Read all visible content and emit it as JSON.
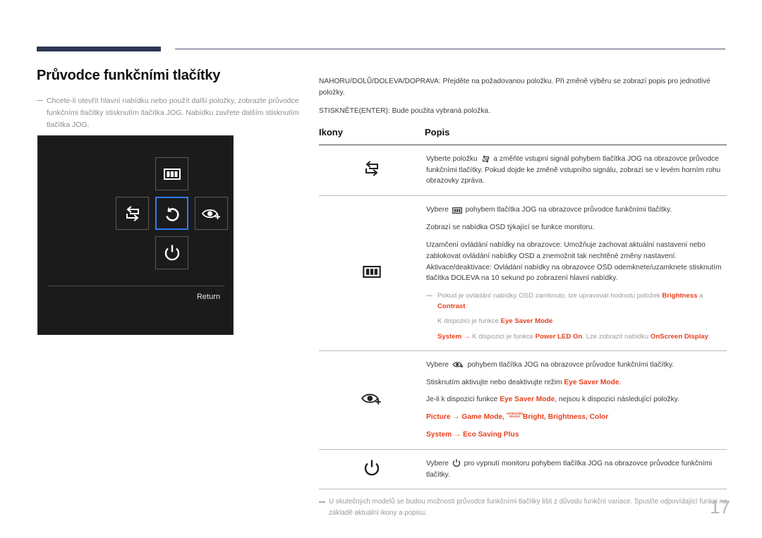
{
  "page": {
    "number": "17",
    "language": "cs"
  },
  "header": {
    "accent_color": "#2e3756",
    "rule_color": "#4a5470"
  },
  "left_column": {
    "title": "Průvodce funkčními tlačítky",
    "note": "Chcete-li otevřít hlavní nabídku nebo použít další položky, zobrazte průvodce funkčními tlačítky stisknutím tlačítka JOG. Nabídku zavřete dalším stisknutím tlačítka JOG.",
    "osd": {
      "background": "#1b1b1b",
      "highlight_color": "#2f7cf6",
      "return_label": "Return",
      "keys": [
        {
          "position": "up",
          "icon": "menu-icon",
          "selected": false
        },
        {
          "position": "left",
          "icon": "source-loop-icon",
          "selected": false
        },
        {
          "position": "center",
          "icon": "return-arrow-icon",
          "selected": true
        },
        {
          "position": "right",
          "icon": "eye-saver-icon",
          "selected": false
        },
        {
          "position": "down",
          "icon": "power-icon",
          "selected": false
        }
      ]
    }
  },
  "right_column": {
    "intro_1": "NAHORU/DOLŮ/DOLEVA/DOPRAVA: Přejděte na požadovanou položku. Při změně výběru se zobrazí popis pro jednotlivé položky.",
    "intro_2": "STISKNĚTE(ENTER): Bude použita vybraná položka.",
    "table": {
      "headers": {
        "icons": "Ikony",
        "description": "Popis"
      },
      "rows": [
        {
          "icon": "source-loop-icon",
          "paragraphs": {
            "p1_a": "Vyberte položku",
            "p1_b": "a změňte vstupní signál pohybem tlačítka JOG na obrazovce průvodce funkčními tlačítky. Pokud dojde ke změně vstupního signálu, zobrazí se v levém horním rohu obrazovky zpráva."
          }
        },
        {
          "icon": "menu-icon",
          "paragraphs": {
            "p1_a": "Vybere",
            "p1_b": "pohybem tlačítka JOG na obrazovce průvodce funkčními tlačítky.",
            "p2": "Zobrazí se nabídka OSD týkající se funkce monitoru.",
            "p3": "Uzamčení ovládání nabídky na obrazovce: Umožňuje zachovat aktuální nastavení nebo zablokovat ovládání nabídky OSD a znemožnit tak nechtěné změny nastavení. Aktivace/deaktivace: Ovládání nabídky na obrazovce OSD odemknete/uzamknete stisknutím tlačítka DOLEVA na 10 sekund po zobrazení hlavní nabídky."
          },
          "sub_notes": {
            "s1_a": "Pokud je ovládání nabídky OSD zamknuto, lze upravovat hodnotu položek",
            "s1_k1": "Brightness",
            "s1_b": "a",
            "s1_k2": "Contrast",
            "s1_c": ".",
            "s2_a": "K dispozici je funkce",
            "s2_k1": "Eye Saver Mode",
            "s2_b": ".",
            "s3_k1": "System",
            "s3_arrow": "→",
            "s3_a": "K dispozici je funkce",
            "s3_k2": "Power LED On",
            "s3_b": ". Lze zobrazit nabídku",
            "s3_k3": "OnScreen Display",
            "s3_c": "."
          }
        },
        {
          "icon": "eye-saver-icon",
          "paragraphs": {
            "p1_a": "Vybere",
            "p1_b": "pohybem tlačítka JOG na obrazovce průvodce funkčními tlačítky.",
            "p2_a": "Stisknutím aktivujte nebo deaktivujte režim",
            "p2_k": "Eye Saver Mode",
            "p2_b": ".",
            "p3_a": "Je-li k dispozici funkce",
            "p3_k": "Eye Saver Mode",
            "p3_b": ", nejsou k dispozici následující položky."
          },
          "paths": {
            "r1_k1": "Picture",
            "r1_arrow": "→",
            "r1_k2": "Game Mode",
            "r1_sep1": ",",
            "r1_magic_top": "SAMSUNG",
            "r1_magic_bottom": "MAGIC",
            "r1_k3": "Bright",
            "r1_sep2": ",",
            "r1_k4": "Brightness",
            "r1_sep3": ",",
            "r1_k5": "Color",
            "r2_k1": "System",
            "r2_arrow": "→",
            "r2_k2": "Eco Saving Plus"
          }
        },
        {
          "icon": "power-icon",
          "paragraphs": {
            "p1_a": "Vybere",
            "p1_b": "pro vypnutí monitoru pohybem tlačítka JOG na obrazovce průvodce funkčními tlačítky."
          }
        }
      ]
    },
    "footnote": "U skutečných modelů se budou možnosti průvodce funkčními tlačítky lišit z důvodu funkční variace. Spusťte odpovídající funkci na základě aktuální ikony a popisu."
  },
  "colors": {
    "accent_red": "#e8401f",
    "navy": "#2e3756",
    "muted": "#9a9a9a"
  }
}
